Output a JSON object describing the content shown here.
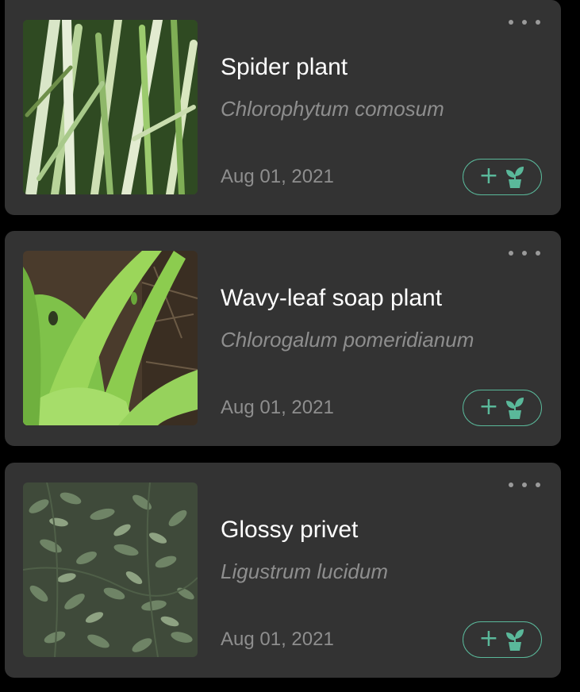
{
  "colors": {
    "background": "#000000",
    "card": "#333333",
    "accent": "#5ab89a",
    "muted_text": "#8e8e8e",
    "title_text": "#ffffff"
  },
  "plants": [
    {
      "common_name": "Spider plant",
      "scientific_name": "Chlorophytum comosum",
      "date": "Aug 01, 2021",
      "add_label": "+",
      "image_icon": "spider-plant-photo"
    },
    {
      "common_name": "Wavy-leaf soap plant",
      "scientific_name": "Chlorogalum pomeridianum",
      "date": "Aug 01, 2021",
      "add_label": "+",
      "image_icon": "soap-plant-photo"
    },
    {
      "common_name": "Glossy privet",
      "scientific_name": "Ligustrum lucidum",
      "date": "Aug 01, 2021",
      "add_label": "+",
      "image_icon": "privet-photo"
    }
  ]
}
